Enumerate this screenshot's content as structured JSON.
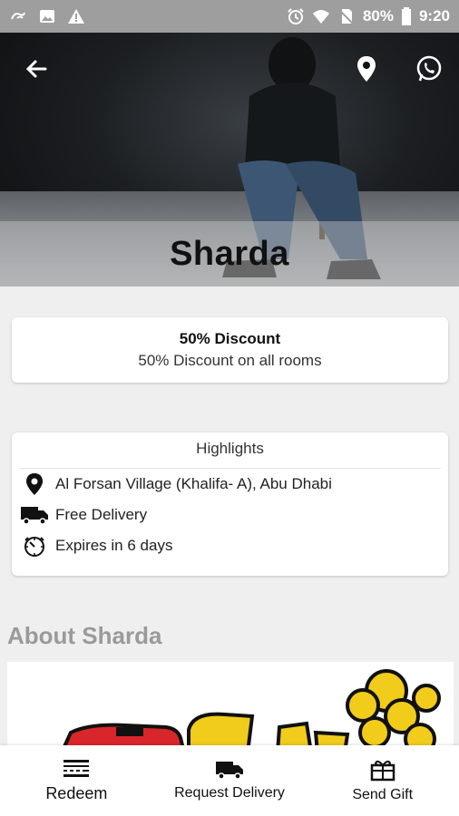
{
  "status_bar": {
    "battery": "80%",
    "time": "9:20",
    "icons": [
      "app-notification-icon",
      "image-icon",
      "warning-icon",
      "alarm-icon",
      "wifi-icon",
      "no-sim-icon",
      "battery-icon"
    ]
  },
  "hero": {
    "title": "Sharda",
    "back_icon": "back-arrow-icon",
    "location_icon": "location-pin-icon",
    "whatsapp_icon": "whatsapp-icon"
  },
  "offer": {
    "title": "50% Discount",
    "subtitle": "50% Discount on all rooms"
  },
  "highlights": {
    "title": "Highlights",
    "items": [
      {
        "icon": "location-pin-icon",
        "text": "Al Forsan Village (Khalifa- A), Abu Dhabi"
      },
      {
        "icon": "truck-icon",
        "text": "Free Delivery"
      },
      {
        "icon": "timer-icon",
        "text": "Expires in 6 days"
      }
    ]
  },
  "about": {
    "title": "About Sharda"
  },
  "bottom_nav": [
    {
      "label": "Redeem",
      "icon": "barcode-icon"
    },
    {
      "label": "Request Delivery",
      "icon": "truck-icon"
    },
    {
      "label": "Send Gift",
      "icon": "gift-icon"
    }
  ],
  "colors": {
    "status_bar": "#9e9e9e",
    "background": "#efefef",
    "about_title": "#9a9a9a",
    "logo_yellow": "#f2cc1b",
    "logo_red": "#d9262a"
  }
}
